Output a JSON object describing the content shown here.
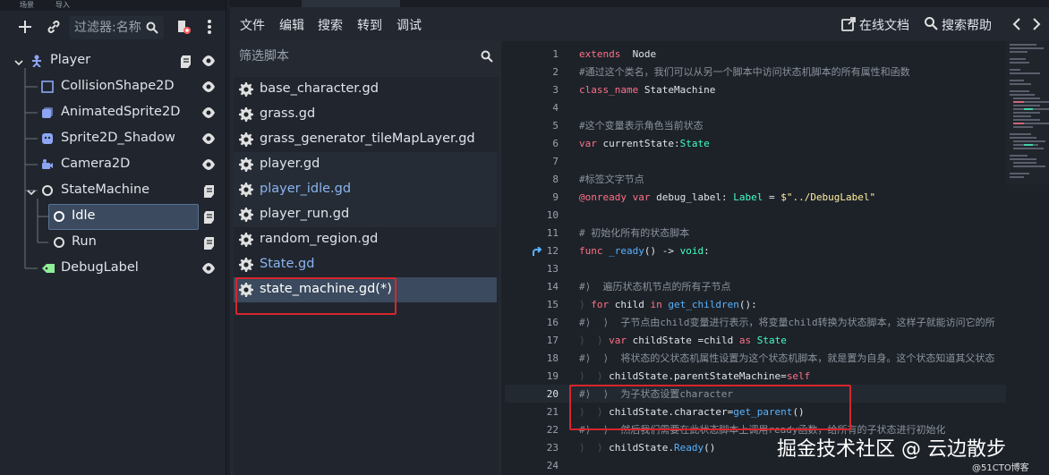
{
  "scene_tree": {
    "tabs": [
      "场景",
      "导入"
    ],
    "filter_placeholder": "过滤器:名称",
    "nodes": [
      {
        "label": "Player",
        "icon": "character-body-icon",
        "color": "#8da5f3"
      },
      {
        "label": "CollisionShape2D",
        "icon": "collision-shape-icon",
        "color": "#8da5f3"
      },
      {
        "label": "AnimatedSprite2D",
        "icon": "animated-sprite-icon",
        "color": "#8da5f3"
      },
      {
        "label": "Sprite2D_Shadow",
        "icon": "sprite-icon",
        "color": "#8da5f3"
      },
      {
        "label": "Camera2D",
        "icon": "camera-icon",
        "color": "#8da5f3"
      },
      {
        "label": "StateMachine",
        "icon": "node-icon",
        "color": "#e0e0e0"
      },
      {
        "label": "Idle",
        "icon": "node-icon",
        "color": "#e0e0e0",
        "selected": true
      },
      {
        "label": "Run",
        "icon": "node-icon",
        "color": "#e0e0e0"
      },
      {
        "label": "DebugLabel",
        "icon": "label-icon",
        "color": "#8eef97"
      }
    ]
  },
  "menu": {
    "items": [
      "文件",
      "编辑",
      "搜索",
      "转到",
      "调试"
    ],
    "online_docs": "在线文档",
    "search_help": "搜索帮助"
  },
  "editor_tabs": [
    "",
    "",
    ""
  ],
  "script_panel": {
    "filter_placeholder": "筛选脚本",
    "scripts": [
      {
        "name": "base_character.gd",
        "color": "#dfe4ea"
      },
      {
        "name": "grass.gd",
        "color": "#dfe4ea"
      },
      {
        "name": "grass_generator_tileMapLayer.gd",
        "color": "#dfe4ea"
      },
      {
        "name": "player.gd",
        "color": "#dfe4ea"
      },
      {
        "name": "player_idle.gd",
        "color": "#8ab4f0"
      },
      {
        "name": "player_run.gd",
        "color": "#dfe4ea"
      },
      {
        "name": "random_region.gd",
        "color": "#dfe4ea"
      },
      {
        "name": "State.gd",
        "color": "#8ab4f0"
      },
      {
        "name": "state_machine.gd(*)",
        "color": "#ffffff",
        "selected": true
      }
    ]
  },
  "code": {
    "lines": [
      {
        "n": "1",
        "parts": [
          [
            "kw",
            "extends"
          ],
          [
            "",
            "  Node"
          ]
        ]
      },
      {
        "n": "2",
        "parts": [
          [
            "cm",
            "#通过这个类名，我们可以从另一个脚本中访问状态机脚本的所有属性和函数"
          ]
        ]
      },
      {
        "n": "3",
        "parts": [
          [
            "kw",
            "class_name"
          ],
          [
            "",
            " StateMachine"
          ]
        ]
      },
      {
        "n": "4",
        "parts": []
      },
      {
        "n": "5",
        "parts": [
          [
            "cm",
            "#这个变量表示角色当前状态"
          ]
        ]
      },
      {
        "n": "6",
        "parts": [
          [
            "kw",
            "var"
          ],
          [
            "",
            " currentState:"
          ],
          [
            "ty",
            "State"
          ]
        ]
      },
      {
        "n": "7",
        "parts": []
      },
      {
        "n": "8",
        "parts": [
          [
            "cm",
            "#标签文字节点"
          ]
        ]
      },
      {
        "n": "9",
        "parts": [
          [
            "kw",
            "@onready var"
          ],
          [
            "",
            " debug_label: "
          ],
          [
            "ty",
            "Label"
          ],
          [
            "",
            " = "
          ],
          [
            "st",
            "$\"../DebugLabel\""
          ]
        ]
      },
      {
        "n": "10",
        "parts": []
      },
      {
        "n": "11",
        "parts": [
          [
            "cm",
            "# 初始化所有的状态脚本"
          ]
        ]
      },
      {
        "n": "12",
        "parts": [
          [
            "kw",
            "func"
          ],
          [
            "",
            " "
          ],
          [
            "fn",
            "_ready"
          ],
          [
            "",
            "() -> "
          ],
          [
            "ty",
            "void"
          ],
          [
            "",
            ":"
          ]
        ]
      },
      {
        "n": "13",
        "parts": []
      },
      {
        "n": "14",
        "parts": [
          [
            "cm",
            "#⟩  遍历状态机节点的所有子节点"
          ]
        ]
      },
      {
        "n": "15",
        "parts": [
          [
            "tabmark",
            "⟩ "
          ],
          [
            "kw",
            "for"
          ],
          [
            "",
            " child "
          ],
          [
            "kw",
            "in"
          ],
          [
            "",
            " "
          ],
          [
            "fn",
            "get_children"
          ],
          [
            "",
            "():"
          ]
        ]
      },
      {
        "n": "16",
        "parts": [
          [
            "cm",
            "#⟩  ⟩  子节点由child变量进行表示，将变量child转换为状态脚本，这样子就能访问它的所"
          ]
        ]
      },
      {
        "n": "17",
        "parts": [
          [
            "tabmark",
            "⟩  ⟩ "
          ],
          [
            "kw",
            "var"
          ],
          [
            "",
            " childState =child "
          ],
          [
            "kw",
            "as"
          ],
          [
            "",
            " "
          ],
          [
            "ty",
            "State"
          ]
        ]
      },
      {
        "n": "18",
        "parts": [
          [
            "cm",
            "#⟩  ⟩  将状态的父状态机属性设置为这个状态机脚本，就是置为自身。这个状态知道其父状态"
          ]
        ]
      },
      {
        "n": "19",
        "parts": [
          [
            "tabmark",
            "⟩  ⟩ "
          ],
          [
            "",
            "childState.parentStateMachine="
          ],
          [
            "kw",
            "self"
          ]
        ]
      },
      {
        "n": "20",
        "parts": [
          [
            "cm",
            "#⟩  ⟩  为子状态设置character"
          ]
        ]
      },
      {
        "n": "21",
        "parts": [
          [
            "tabmark",
            "⟩  ⟩ "
          ],
          [
            "",
            "childState.character="
          ],
          [
            "fn",
            "get_parent"
          ],
          [
            "",
            "()"
          ]
        ]
      },
      {
        "n": "22",
        "parts": [
          [
            "cm",
            "#⟩  ⟩  然后我们需要在此状态脚本上调用ready函数，给所有的子状态进行初始化"
          ]
        ]
      },
      {
        "n": "23",
        "parts": [
          [
            "tabmark",
            "⟩  ⟩ "
          ],
          [
            "",
            "childState."
          ],
          [
            "fn",
            "Ready"
          ],
          [
            "",
            "()"
          ]
        ]
      },
      {
        "n": "24",
        "parts": []
      }
    ],
    "current_line": "20",
    "fold_line": "12"
  },
  "watermark": {
    "main": "掘金技术社区 @ 云边散步",
    "sub": "@51CTO博客"
  },
  "colors": {
    "accent": "#8da5f3",
    "highlight_box": "#d6262c",
    "selected_row": "#3b4a5e"
  }
}
